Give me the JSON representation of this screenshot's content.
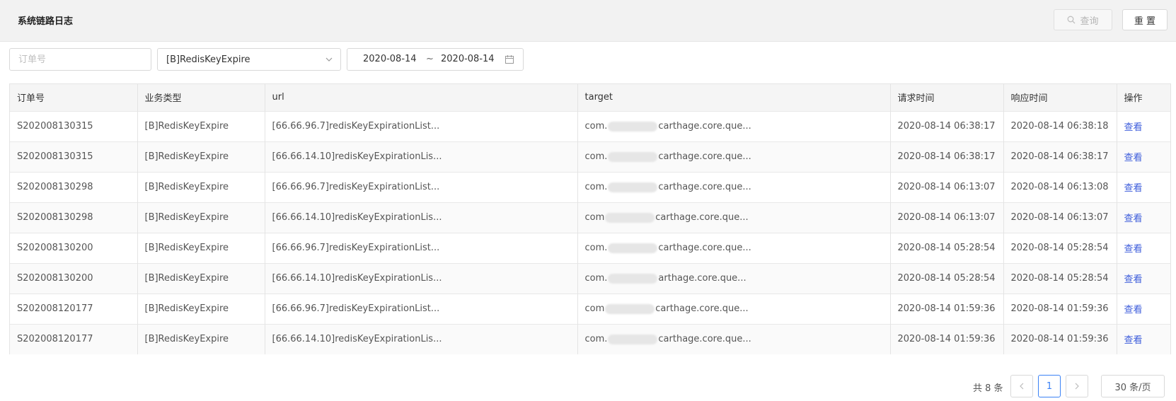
{
  "header": {
    "title": "系统链路日志",
    "query_label": "查询",
    "reset_label": "重 置"
  },
  "filters": {
    "order_placeholder": "订单号",
    "type_value": "[B]RedisKeyExpire",
    "date_start": "2020-08-14",
    "date_sep": "~",
    "date_end": "2020-08-14"
  },
  "table": {
    "columns": [
      "订单号",
      "业务类型",
      "url",
      "target",
      "请求时间",
      "响应时间",
      "操作"
    ],
    "rows": [
      {
        "order": "S202008130315",
        "type": "[B]RedisKeyExpire",
        "url": "[66.66.96.7]redisKeyExpirationList...",
        "target_pre": "com.",
        "target_post": "carthage.core.que...",
        "req": "2020-08-14 06:38:17",
        "resp": "2020-08-14 06:38:18",
        "action": "查看"
      },
      {
        "order": "S202008130315",
        "type": "[B]RedisKeyExpire",
        "url": "[66.66.14.10]redisKeyExpirationLis...",
        "target_pre": "com.",
        "target_post": "carthage.core.que...",
        "req": "2020-08-14 06:38:17",
        "resp": "2020-08-14 06:38:17",
        "action": "查看"
      },
      {
        "order": "S202008130298",
        "type": "[B]RedisKeyExpire",
        "url": "[66.66.96.7]redisKeyExpirationList...",
        "target_pre": "com.",
        "target_post": "carthage.core.que...",
        "req": "2020-08-14 06:13:07",
        "resp": "2020-08-14 06:13:08",
        "action": "查看"
      },
      {
        "order": "S202008130298",
        "type": "[B]RedisKeyExpire",
        "url": "[66.66.14.10]redisKeyExpirationLis...",
        "target_pre": "com",
        "target_post": "carthage.core.que...",
        "req": "2020-08-14 06:13:07",
        "resp": "2020-08-14 06:13:07",
        "action": "查看"
      },
      {
        "order": "S202008130200",
        "type": "[B]RedisKeyExpire",
        "url": "[66.66.96.7]redisKeyExpirationList...",
        "target_pre": "com.",
        "target_post": "carthage.core.que...",
        "req": "2020-08-14 05:28:54",
        "resp": "2020-08-14 05:28:54",
        "action": "查看"
      },
      {
        "order": "S202008130200",
        "type": "[B]RedisKeyExpire",
        "url": "[66.66.14.10]redisKeyExpirationLis...",
        "target_pre": "com.",
        "target_post": "arthage.core.que...",
        "req": "2020-08-14 05:28:54",
        "resp": "2020-08-14 05:28:54",
        "action": "查看"
      },
      {
        "order": "S202008120177",
        "type": "[B]RedisKeyExpire",
        "url": "[66.66.96.7]redisKeyExpirationList...",
        "target_pre": "com",
        "target_post": "carthage.core.que...",
        "req": "2020-08-14 01:59:36",
        "resp": "2020-08-14 01:59:36",
        "action": "查看"
      },
      {
        "order": "S202008120177",
        "type": "[B]RedisKeyExpire",
        "url": "[66.66.14.10]redisKeyExpirationLis...",
        "target_pre": "com.",
        "target_post": "carthage.core.que...",
        "req": "2020-08-14 01:59:36",
        "resp": "2020-08-14 01:59:36",
        "action": "查看"
      }
    ]
  },
  "pager": {
    "total": "共 8 条",
    "current_page": "1",
    "page_size": "30 条/页"
  },
  "colors": {
    "accent": "#3b82f6",
    "link": "#3b5bdb"
  }
}
